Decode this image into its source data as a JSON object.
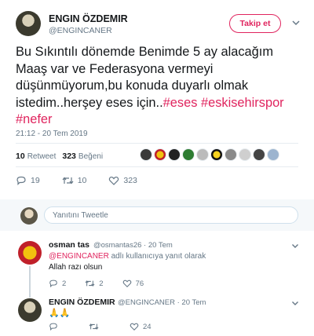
{
  "tweet": {
    "author_name": "ENGIN ÖZDEMIR",
    "author_handle": "@ENGINCANER",
    "follow_label": "Takip et",
    "text_plain": "Bu Sıkıntılı dönemde Benimde 5 ay alacağım Maaş var ve Federasyona vermeyi düşünmüyorum,bu konuda duyarlı olmak istedim..herşey eses için..",
    "hashtags": [
      "#eses",
      "#eskisehirspor",
      "#nefer"
    ],
    "timestamp": "21:12 - 20 Tem 2019",
    "retweet_count": "10",
    "retweet_label": "Retweet",
    "like_count": "323",
    "like_label": "Beğeni",
    "actions": {
      "replies": "19",
      "retweets": "10",
      "likes": "323"
    }
  },
  "reply_box": {
    "placeholder": "Yanıtını Tweetle"
  },
  "replies": [
    {
      "name": "osman tas",
      "handle_time": "@osmantas26 · 20 Tem",
      "mention": "@ENGINCANER",
      "reply_note": " adlı kullanıcıya yanıt olarak",
      "text": "Allah razı olsun",
      "actions": {
        "replies": "2",
        "retweets": "2",
        "likes": "76"
      }
    },
    {
      "name": "ENGIN ÖZDEMIR",
      "handle_time": "@ENGINCANER · 20 Tem",
      "text": "🙏🙏",
      "actions": {
        "replies": "",
        "retweets": "",
        "likes": "24"
      }
    }
  ],
  "colors": {
    "accent": "#e0245e",
    "muted": "#657786",
    "divider": "#e6ecf0"
  },
  "icons": [
    "chevron-down-icon",
    "reply-icon",
    "retweet-icon",
    "like-icon"
  ]
}
